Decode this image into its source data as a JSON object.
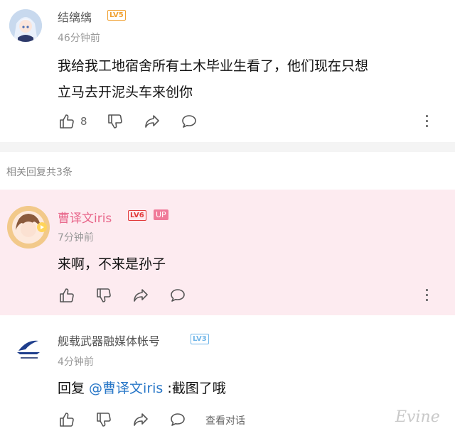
{
  "top_comment": {
    "username": "结缡缡",
    "level": "LV5",
    "time": "46分钟前",
    "text_line1": "我给我工地宿舍所有土木毕业生看了，他们现在只想",
    "text_line2": "立马去开泥头车来创你",
    "like_count": "8"
  },
  "replies_header": "相关回复共3条",
  "reply1": {
    "username": "曹译文iris",
    "level": "LV6",
    "badge": "UP",
    "time": "7分钟前",
    "text": "来啊，不来是孙子"
  },
  "reply2": {
    "username": "舰载武器融媒体帐号",
    "level": "LV3",
    "time": "4分钟前",
    "text_prefix": "回复 ",
    "mention": "@曹译文iris",
    "text_suffix": " :截图了哦",
    "view_conversation": "查看对话"
  },
  "watermark": "Evine",
  "colors": {
    "pink_bg": "#fdebf0",
    "up_pink": "#f07a99",
    "mention_blue": "#2a78c8",
    "lv5_orange": "#f0a030",
    "lv3_blue": "#6fb5e8"
  }
}
